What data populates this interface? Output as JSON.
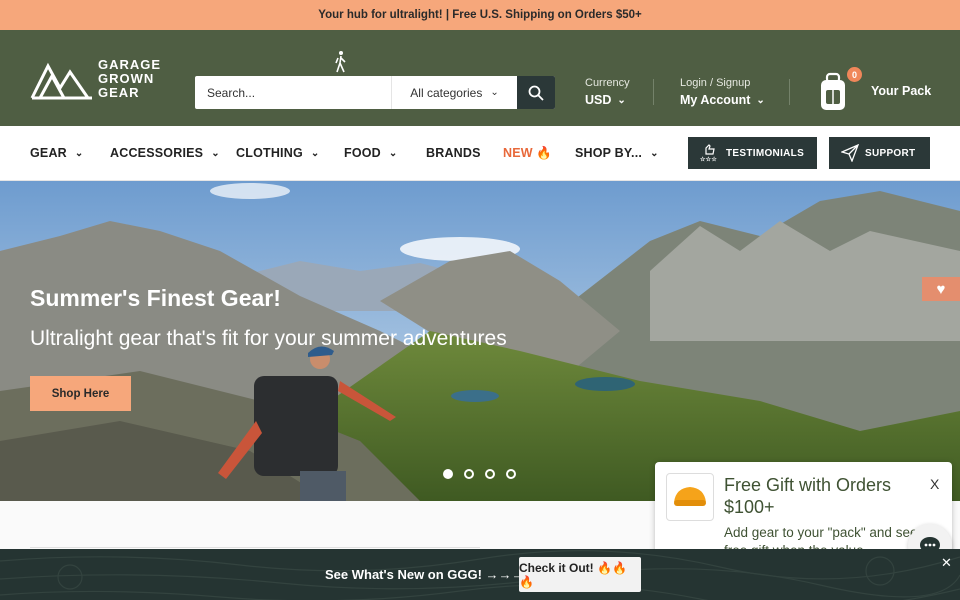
{
  "promo": {
    "text": "Your hub for ultralight! | Free U.S. Shipping on Orders $50+"
  },
  "header": {
    "logo_lines": [
      "GARAGE",
      "GROWN",
      "GEAR"
    ],
    "search": {
      "placeholder": "Search...",
      "category": "All categories"
    },
    "currency": {
      "label": "Currency",
      "value": "USD"
    },
    "account": {
      "label": "Login / Signup",
      "value": "My Account"
    },
    "cart": {
      "count": "0",
      "label": "Your Pack"
    }
  },
  "nav": {
    "items": [
      {
        "label": "GEAR",
        "dropdown": true
      },
      {
        "label": "ACCESSORIES",
        "dropdown": true
      },
      {
        "label": "CLOTHING",
        "dropdown": true
      },
      {
        "label": "FOOD",
        "dropdown": true
      },
      {
        "label": "BRANDS",
        "dropdown": false
      },
      {
        "label": "NEW 🔥",
        "dropdown": false
      },
      {
        "label": "SHOP BY...",
        "dropdown": true
      }
    ],
    "testimonials": "TESTIMONIALS",
    "support": "SUPPORT"
  },
  "hero": {
    "title": "Summer's Finest Gear!",
    "subtitle": "Ultralight gear that's fit for your summer adventures",
    "cta": "Shop Here",
    "slides": 4,
    "active_slide": 1
  },
  "gift_popup": {
    "title": "Free Gift with Orders $100+",
    "close": "X",
    "description": "Add gear to your \"pack\" and see the free gift when the value"
  },
  "bottom_bar": {
    "text": "See What's New on GGG! →→→",
    "cta": "Check it Out! 🔥🔥🔥",
    "close": "✕"
  },
  "colors": {
    "promo_bg": "#f6a77b",
    "header_bg": "#4f5e43",
    "dark_teal": "#2b3838",
    "accent": "#e8683a"
  }
}
